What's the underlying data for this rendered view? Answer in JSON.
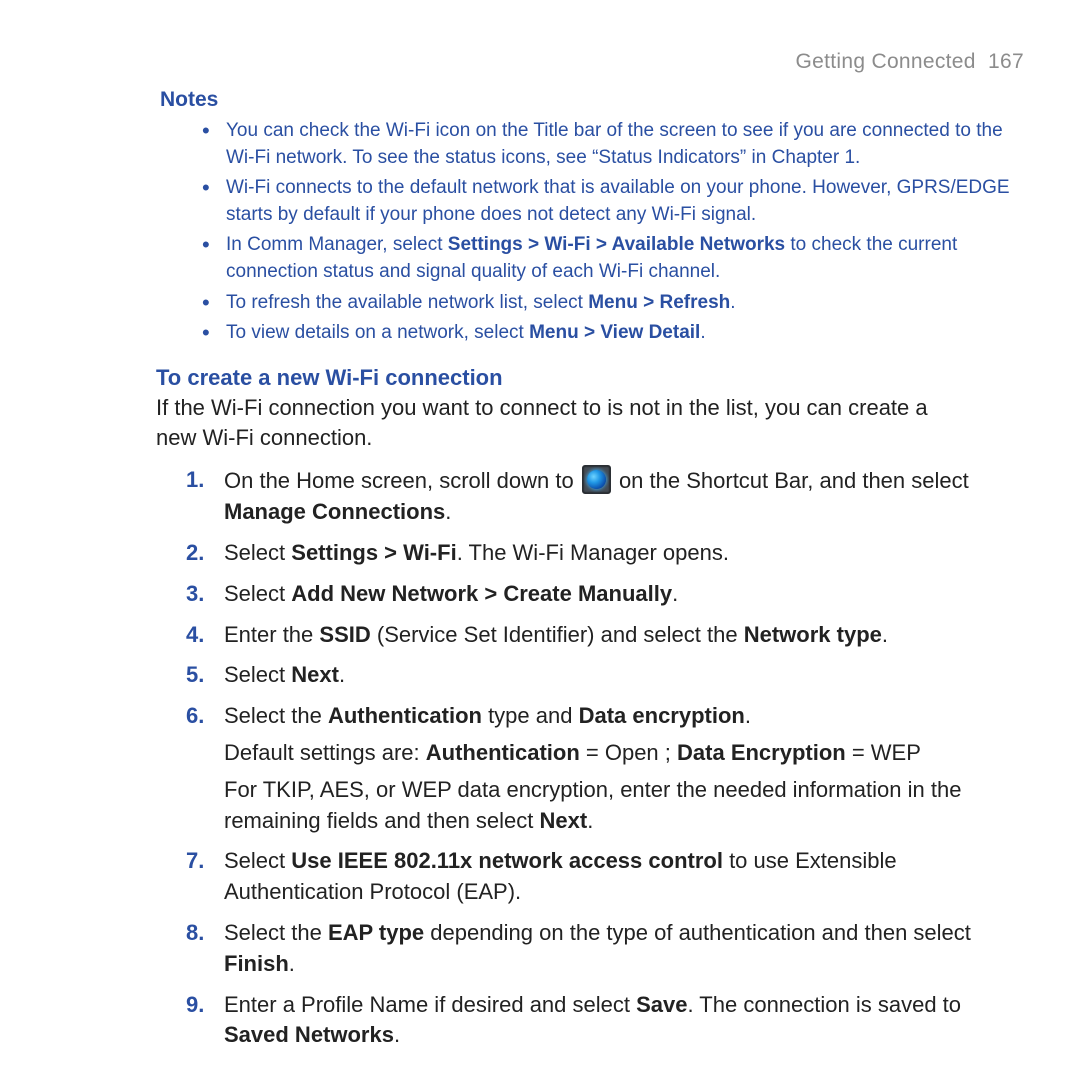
{
  "header": {
    "chapter_title": "Getting Connected",
    "page_number": "167"
  },
  "notes": {
    "heading": "Notes",
    "items": [
      {
        "pre": "You can check the Wi-Fi icon on the Title bar of the screen to see if you are connected to the Wi-Fi network. To see the status icons, see “Status Indicators” in Chapter 1.",
        "bold1": "",
        "mid": "",
        "bold2": "",
        "post": ""
      },
      {
        "pre": "Wi-Fi connects to the default network that is available on your phone. However, GPRS/EDGE starts by default if your phone does not detect any Wi-Fi signal.",
        "bold1": "",
        "mid": "",
        "bold2": "",
        "post": ""
      },
      {
        "pre": "In Comm Manager, select ",
        "bold1": "Settings > Wi-Fi > Available Networks",
        "mid": " to check the current connection status and signal quality of each Wi-Fi channel.",
        "bold2": "",
        "post": ""
      },
      {
        "pre": "To refresh the available network list, select ",
        "bold1": "Menu > Refresh",
        "mid": ".",
        "bold2": "",
        "post": ""
      },
      {
        "pre": "To view details on a network, select ",
        "bold1": "Menu > View Detail",
        "mid": ".",
        "bold2": "",
        "post": ""
      }
    ]
  },
  "section": {
    "heading": "To create a new Wi-Fi connection",
    "intro": "If the Wi-Fi connection you want to connect to is not in the list, you can create a new Wi-Fi connection."
  },
  "steps": [
    {
      "num": "1.",
      "parts": {
        "pre": "On the Home screen, scroll down to ",
        "icon": "settings-globe-icon",
        "mid": " on the Shortcut Bar, and then select ",
        "b1": "Manage Connections",
        "post": "."
      }
    },
    {
      "num": "2.",
      "parts": {
        "pre": "Select ",
        "b1": "Settings > Wi-Fi",
        "post": ". The Wi-Fi Manager opens."
      }
    },
    {
      "num": "3.",
      "parts": {
        "pre": "Select ",
        "b1": "Add New Network > Create Manually",
        "post": "."
      }
    },
    {
      "num": "4.",
      "parts": {
        "pre": "Enter the ",
        "b1": "SSID",
        "mid": " (Service Set Identifier) and select the ",
        "b2": "Network type",
        "post": "."
      }
    },
    {
      "num": "5.",
      "parts": {
        "pre": "Select ",
        "b1": "Next",
        "post": "."
      }
    },
    {
      "num": "6.",
      "parts": {
        "pre": "Select the ",
        "b1": "Authentication",
        "mid": " type and ",
        "b2": "Data encryption",
        "post": ".",
        "sub1_pre": "Default settings are: ",
        "sub1_b1": "Authentication",
        "sub1_mid": " = Open ; ",
        "sub1_b2": "Data Encryption",
        "sub1_post": " = WEP",
        "sub2_pre": "For TKIP, AES, or WEP data encryption, enter the needed information in the remaining fields and then select ",
        "sub2_b1": "Next",
        "sub2_post": "."
      }
    },
    {
      "num": "7.",
      "parts": {
        "pre": "Select ",
        "b1": "Use IEEE 802.11x network access control",
        "post": " to use Extensible Authentication Protocol (EAP)."
      }
    },
    {
      "num": "8.",
      "parts": {
        "pre": "Select the ",
        "b1": "EAP type",
        "mid": " depending on the type of authentication and then select ",
        "b2": "Finish",
        "post": "."
      }
    },
    {
      "num": "9.",
      "parts": {
        "pre": "Enter a Profile Name if desired and select ",
        "b1": "Save",
        "mid": ". The connection is saved to ",
        "b2": "Saved Networks",
        "post": "."
      }
    }
  ]
}
